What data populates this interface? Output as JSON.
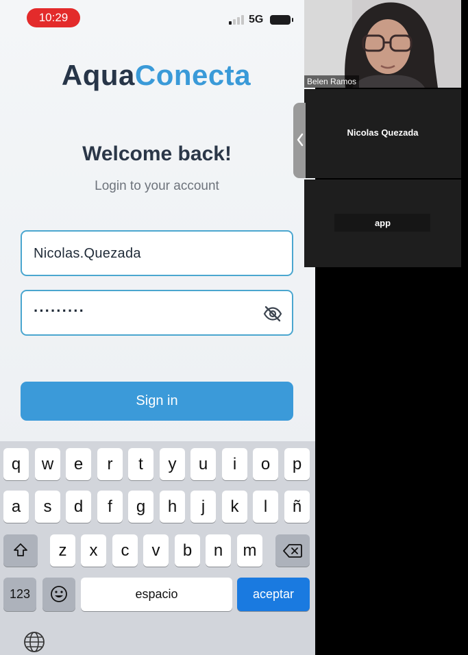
{
  "status_bar": {
    "time": "10:29",
    "network": "5G"
  },
  "app": {
    "logo_part1": "Aqua",
    "logo_part2": "Conecta",
    "welcome": "Welcome back!",
    "subtitle": "Login to your account",
    "username_value": "Nicolas.Quezada",
    "password_value": "·········",
    "signin_label": "Sign in",
    "colors": {
      "brand_dark": "#273548",
      "brand_accent": "#3a9ad8",
      "button": "#3b9ad9",
      "field_border": "#4aa6cf"
    }
  },
  "keyboard": {
    "row1": [
      "q",
      "w",
      "e",
      "r",
      "t",
      "y",
      "u",
      "i",
      "o",
      "p"
    ],
    "row2": [
      "a",
      "s",
      "d",
      "f",
      "g",
      "h",
      "j",
      "k",
      "l",
      "ñ"
    ],
    "row3": [
      "z",
      "x",
      "c",
      "v",
      "b",
      "n",
      "m"
    ],
    "numbers_label": "123",
    "space_label": "espacio",
    "accept_label": "aceptar",
    "icons": {
      "shift": "shift-icon",
      "backspace": "backspace-icon",
      "emoji": "emoji-icon",
      "globe": "globe-icon"
    }
  },
  "call": {
    "participants": [
      {
        "name": "Belen Ramos",
        "video": true
      },
      {
        "name": "Nicolas Quezada",
        "video": false
      },
      {
        "name": "app",
        "video": false
      }
    ]
  }
}
